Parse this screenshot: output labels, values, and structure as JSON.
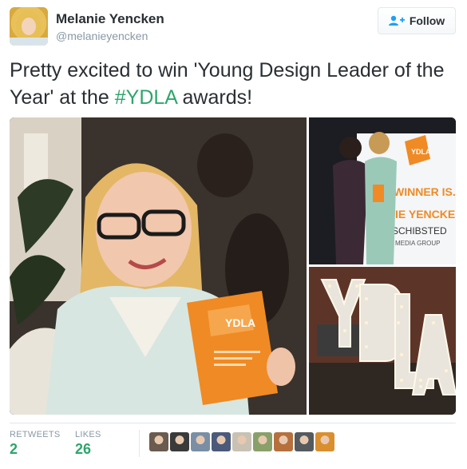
{
  "user": {
    "display_name": "Melanie Yencken",
    "handle": "@melanieyencken"
  },
  "follow_button": {
    "label": "Follow",
    "icon": "add-user-icon"
  },
  "tweet": {
    "text_before": "Pretty excited to win 'Young Design Leader of the Year' at the ",
    "hashtag": "#YDLA",
    "text_after": " awards!"
  },
  "media": {
    "main": {
      "trophy_logo": "YDLA"
    },
    "right_top": {
      "logo": "YDLA",
      "screen_line1": "WINNER IS...",
      "screen_line2": "IE YENCKEN",
      "screen_line3": "SCHIBSTED",
      "screen_line4": "MEDIA GROUP"
    },
    "right_bottom": {
      "letters": [
        "Y",
        "D",
        "L",
        "A"
      ]
    }
  },
  "stats": {
    "retweets_label": "RETWEETS",
    "retweets_value": "2",
    "likes_label": "LIKES",
    "likes_value": "26"
  },
  "likers": [
    {
      "name": "liker-1",
      "color": "#6b5a4e"
    },
    {
      "name": "liker-2",
      "color": "#3a3a3a"
    },
    {
      "name": "liker-3",
      "color": "#7a8fa6"
    },
    {
      "name": "liker-4",
      "color": "#4b5a7a"
    },
    {
      "name": "liker-5",
      "color": "#c9c2b4"
    },
    {
      "name": "liker-6",
      "color": "#8aa06b"
    },
    {
      "name": "liker-7",
      "color": "#b5703d"
    },
    {
      "name": "liker-8",
      "color": "#555a5e"
    },
    {
      "name": "liker-9",
      "color": "#d98f2e"
    }
  ],
  "colors": {
    "accent_green": "#2ca66a",
    "muted": "#8899a6",
    "text": "#292f33",
    "orange": "#f08a24"
  }
}
